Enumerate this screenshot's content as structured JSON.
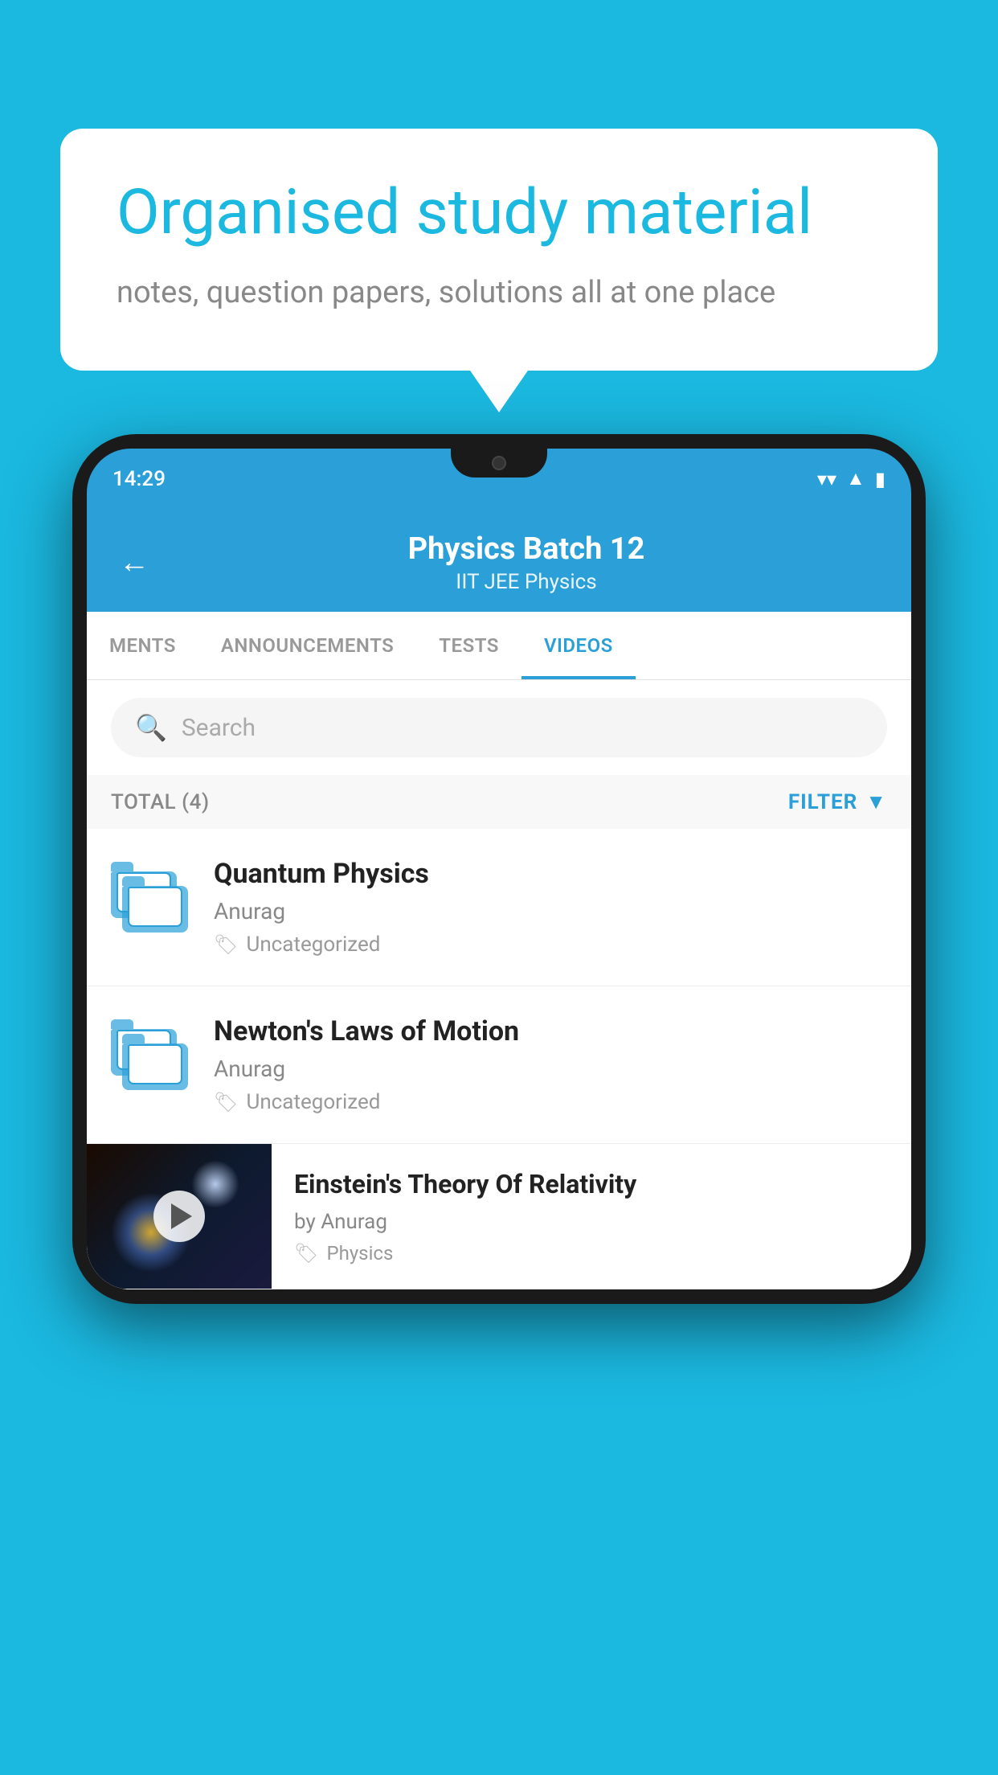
{
  "background_color": "#1bb8e0",
  "speech_bubble": {
    "title": "Organised study material",
    "subtitle": "notes, question papers, solutions all at one place"
  },
  "phone": {
    "status_bar": {
      "time": "14:29"
    },
    "header": {
      "back_label": "←",
      "title": "Physics Batch 12",
      "subtitle_parts": [
        "IIT JEE",
        "Physics"
      ]
    },
    "tabs": [
      {
        "label": "MENTS",
        "active": false
      },
      {
        "label": "ANNOUNCEMENTS",
        "active": false
      },
      {
        "label": "TESTS",
        "active": false
      },
      {
        "label": "VIDEOS",
        "active": true
      }
    ],
    "search": {
      "placeholder": "Search"
    },
    "filter_row": {
      "total_label": "TOTAL (4)",
      "filter_label": "FILTER"
    },
    "videos": [
      {
        "id": "quantum",
        "title": "Quantum Physics",
        "author": "Anurag",
        "tag": "Uncategorized",
        "has_thumbnail": false
      },
      {
        "id": "newton",
        "title": "Newton's Laws of Motion",
        "author": "Anurag",
        "tag": "Uncategorized",
        "has_thumbnail": false
      },
      {
        "id": "einstein",
        "title": "Einstein's Theory Of Relativity",
        "author_prefix": "by",
        "author": "Anurag",
        "tag": "Physics",
        "has_thumbnail": true
      }
    ]
  }
}
